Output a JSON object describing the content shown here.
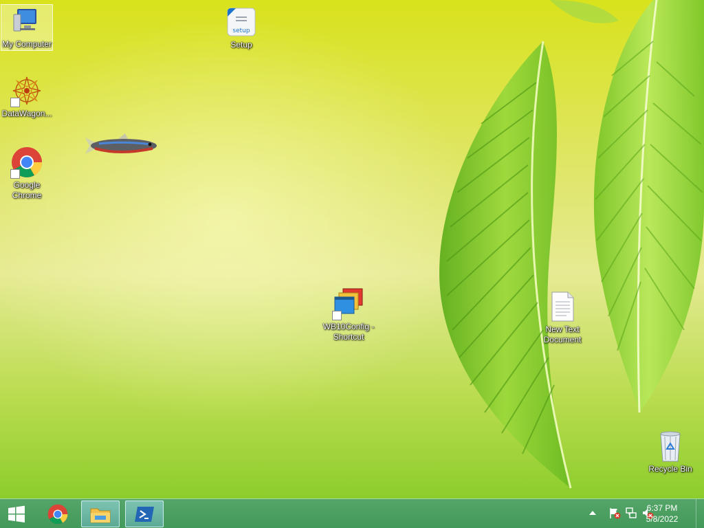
{
  "desktop": {
    "icons": {
      "my_computer": {
        "label": "My Computer"
      },
      "setup": {
        "label": "Setup",
        "badge": "setup"
      },
      "datawagon": {
        "label": "DataWagon..."
      },
      "chrome": {
        "label": "Google Chrome"
      },
      "wb10config": {
        "label": "WB10Config - Shortcut"
      },
      "new_text": {
        "label": "New Text Document"
      },
      "recycle_bin": {
        "label": "Recycle Bin"
      }
    }
  },
  "taskbar": {
    "start_icon": "windows-logo-icon",
    "pinned": [
      {
        "name": "chrome",
        "icon": "chrome-icon"
      },
      {
        "name": "file-explorer",
        "icon": "folder-icon"
      },
      {
        "name": "powershell",
        "icon": "powershell-icon"
      }
    ],
    "tray": {
      "chevron": "show-hidden-icons",
      "icons": [
        "action-center-flag-icon",
        "network-icon",
        "volume-muted-icon"
      ]
    },
    "clock": {
      "time": "6:37 PM",
      "date": "5/8/2022"
    }
  },
  "colors": {
    "taskbar": "#3c9654",
    "desktop_top": "#d9e21c",
    "desktop_bottom": "#8ccd2c"
  }
}
